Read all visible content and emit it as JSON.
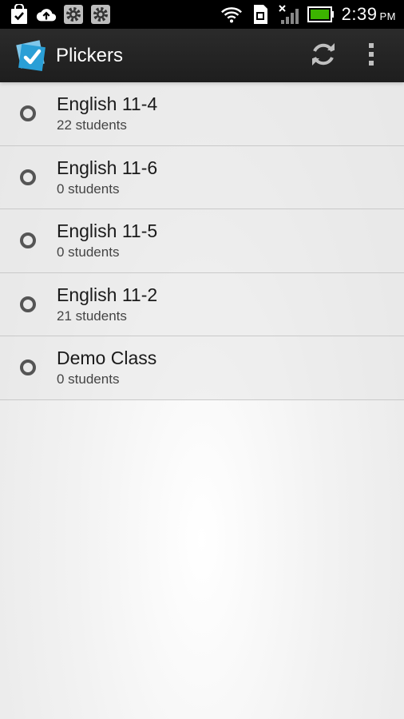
{
  "status_bar": {
    "icons_left": [
      "shopping-bag-check-icon",
      "cloud-upload-icon",
      "gear-icon",
      "gear-icon"
    ],
    "icons_right": [
      "wifi-icon",
      "sim-card-icon",
      "no-signal-icon",
      "battery-icon"
    ],
    "time": "2:39",
    "ampm": "PM"
  },
  "action_bar": {
    "title": "Plickers",
    "background": "#222222",
    "actions": [
      "refresh-icon",
      "overflow-menu-icon"
    ]
  },
  "classes": [
    {
      "name": "English 11-4",
      "students": "22 students"
    },
    {
      "name": "English 11-6",
      "students": "0 students"
    },
    {
      "name": "English 11-5",
      "students": "0 students"
    },
    {
      "name": "English 11-2",
      "students": "21 students"
    },
    {
      "name": "Demo Class",
      "students": "0 students"
    }
  ],
  "colors": {
    "logo_blue": "#2a9fd6",
    "battery_green": "#3cb300",
    "radio_ring": "#555555"
  }
}
